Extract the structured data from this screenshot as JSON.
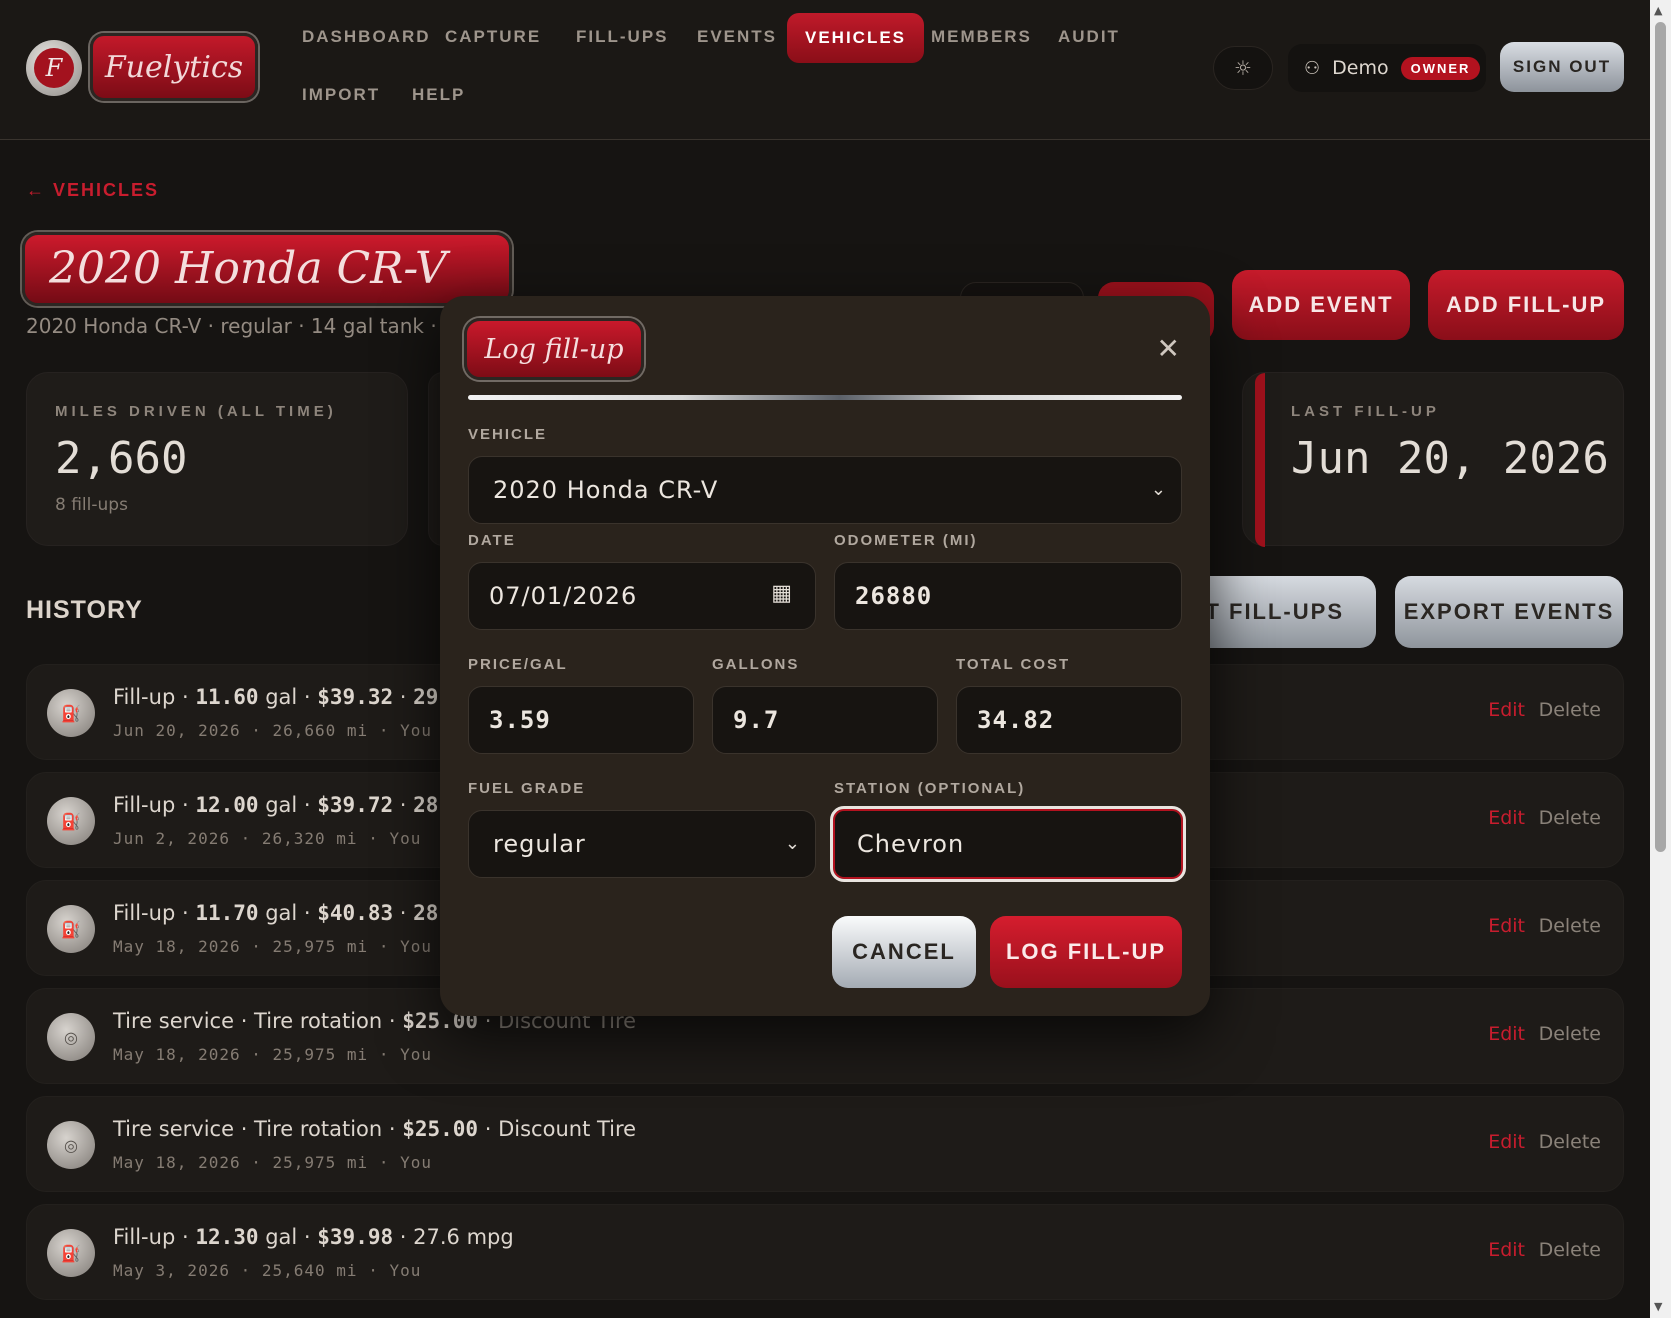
{
  "brand": {
    "logo_letter": "F",
    "wordmark": "Fuelytics"
  },
  "nav": {
    "items": [
      {
        "label": "DASHBOARD"
      },
      {
        "label": "CAPTURE"
      },
      {
        "label": "FILL-UPS"
      },
      {
        "label": "EVENTS"
      },
      {
        "label": "VEHICLES"
      },
      {
        "label": "MEMBERS"
      },
      {
        "label": "AUDIT"
      },
      {
        "label": "IMPORT"
      },
      {
        "label": "HELP"
      }
    ],
    "active": "VEHICLES"
  },
  "user": {
    "name": "Demo",
    "role_badge": "OWNER",
    "sign_out": "SIGN OUT"
  },
  "page": {
    "back_link": "← VEHICLES",
    "title": "2020 Honda CR-V",
    "subtitle": "2020 Honda CR-V · regular · 14 gal tank · ir",
    "add_event": "ADD EVENT",
    "add_fillup": "ADD FILL-UP"
  },
  "stats": {
    "miles": {
      "label": "MILES DRIVEN (ALL TIME)",
      "value": "2,660",
      "foot": "8 fill-ups"
    },
    "last_fillup": {
      "label": "LAST FILL-UP",
      "value": "Jun 20, 2026"
    }
  },
  "history": {
    "title": "HISTORY",
    "export_fillups": "RT FILL-UPS",
    "export_events": "EXPORT EVENTS",
    "edit_label": "Edit",
    "delete_label": "Delete",
    "rows": [
      {
        "type": "Fill-up",
        "gal": "11.60",
        "cost": "$39.32",
        "rest": "29.3",
        "meta": "Jun 20, 2026 · 26,660 mi · You"
      },
      {
        "type": "Fill-up",
        "gal": "12.00",
        "cost": "$39.72",
        "rest": "28.8",
        "meta": "Jun 2, 2026 · 26,320 mi · You"
      },
      {
        "type": "Fill-up",
        "gal": "11.70",
        "cost": "$40.83",
        "rest": "28.6",
        "meta": "May 18, 2026 · 25,975 mi · You"
      },
      {
        "type": "Tire service",
        "desc": "Tire rotation",
        "cost": "$25.00",
        "place": "Discount Tire",
        "meta": "May 18, 2026 · 25,975 mi · You"
      },
      {
        "type": "Tire service",
        "desc": "Tire rotation",
        "cost": "$25.00",
        "place": "Discount Tire",
        "meta": "May 18, 2026 · 25,975 mi · You"
      },
      {
        "type": "Fill-up",
        "gal": "12.30",
        "cost": "$39.98",
        "rest": "27.6 mpg",
        "meta": "May 3, 2026 · 25,640 mi · You"
      }
    ]
  },
  "modal": {
    "title": "Log fill-up",
    "vehicle_label": "VEHICLE",
    "vehicle_value": "2020 Honda CR-V",
    "date_label": "DATE",
    "date_value": "07/01/2026",
    "odometer_label": "ODOMETER (MI)",
    "odometer_value": "26880",
    "price_label": "PRICE/GAL",
    "price_value": "3.59",
    "gallons_label": "GALLONS",
    "gallons_value": "9.7",
    "total_label": "TOTAL COST",
    "total_value": "34.82",
    "grade_label": "FUEL GRADE",
    "grade_value": "regular",
    "station_label": "STATION (OPTIONAL)",
    "station_value": "Chevron",
    "cancel": "CANCEL",
    "submit": "LOG FILL-UP"
  },
  "colors": {
    "accent": "#c01a2a",
    "background": "#161412",
    "card": "#1f1c19",
    "modal": "#2a231c"
  },
  "icons": {
    "theme": "sun-icon",
    "user": "user-icon",
    "close": "close-icon",
    "calendar": "calendar-icon",
    "chevron": "chevron-down-icon",
    "fuel": "fuel-pump-icon",
    "tire": "tire-icon"
  }
}
